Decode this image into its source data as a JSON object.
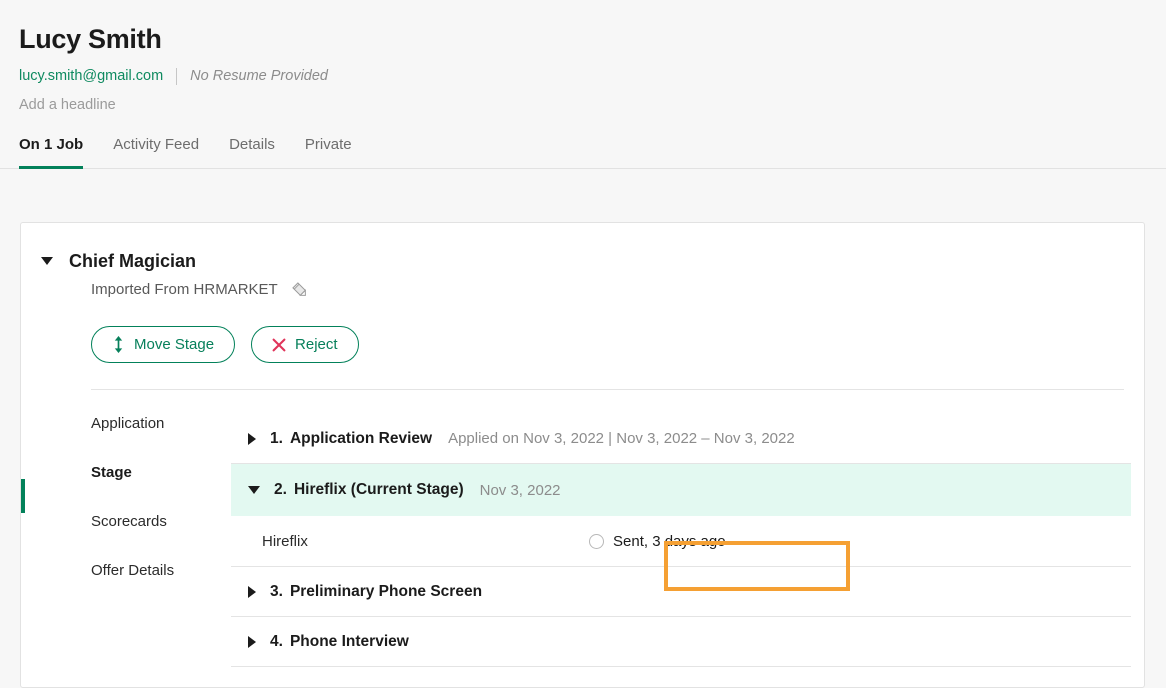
{
  "header": {
    "candidate_name": "Lucy Smith",
    "email": "lucy.smith@gmail.com",
    "resume_status": "No Resume Provided",
    "headline_placeholder": "Add a headline",
    "email_color": "#0f8a60"
  },
  "tabs": [
    {
      "label": "On 1 Job",
      "active": true
    },
    {
      "label": "Activity Feed",
      "active": false
    },
    {
      "label": "Details",
      "active": false
    },
    {
      "label": "Private",
      "active": false
    }
  ],
  "job_card": {
    "title": "Chief Magician",
    "source": "Imported From HRMARKET",
    "edit_icon": "pencil-icon",
    "collapse_icon": "caret-down-icon",
    "actions": [
      {
        "label": "Move Stage",
        "icon": "updown-arrow-icon",
        "icon_color": "#07805b",
        "text_color": "#07805b"
      },
      {
        "label": "Reject",
        "icon": "x-icon",
        "icon_color": "#e0345a",
        "text_color": "#07805b"
      }
    ]
  },
  "side_nav": [
    {
      "label": "Application",
      "active": false
    },
    {
      "label": "Stage",
      "active": true
    },
    {
      "label": "Scorecards",
      "active": false
    },
    {
      "label": "Offer Details",
      "active": false
    }
  ],
  "stages": [
    {
      "number": "1.",
      "name": "Application Review",
      "meta": "Applied on Nov 3, 2022 | Nov 3, 2022 – Nov 3, 2022",
      "expanded": false,
      "current": false,
      "caret": "caret-right-icon"
    },
    {
      "number": "2.",
      "name": "Hireflix (Current Stage)",
      "meta": "Nov 3, 2022",
      "expanded": true,
      "current": true,
      "caret": "caret-down-icon"
    },
    {
      "number": "3.",
      "name": "Preliminary Phone Screen",
      "meta": "",
      "expanded": false,
      "current": false,
      "caret": "caret-right-icon"
    },
    {
      "number": "4.",
      "name": "Phone Interview",
      "meta": "",
      "expanded": false,
      "current": false,
      "caret": "caret-right-icon"
    }
  ],
  "sub_row": {
    "label": "Hireflix",
    "status_icon": "circle-empty-icon",
    "status_text": "Sent, 3 days ago"
  },
  "annotation": {
    "color": "#f5a033",
    "target": "Sent, 3 days ago"
  },
  "theme": {
    "accent_green": "#03815a",
    "current_stage_bg": "#e3f9f1",
    "page_bg": "#f7f7f7",
    "reject_red": "#e0345a"
  }
}
